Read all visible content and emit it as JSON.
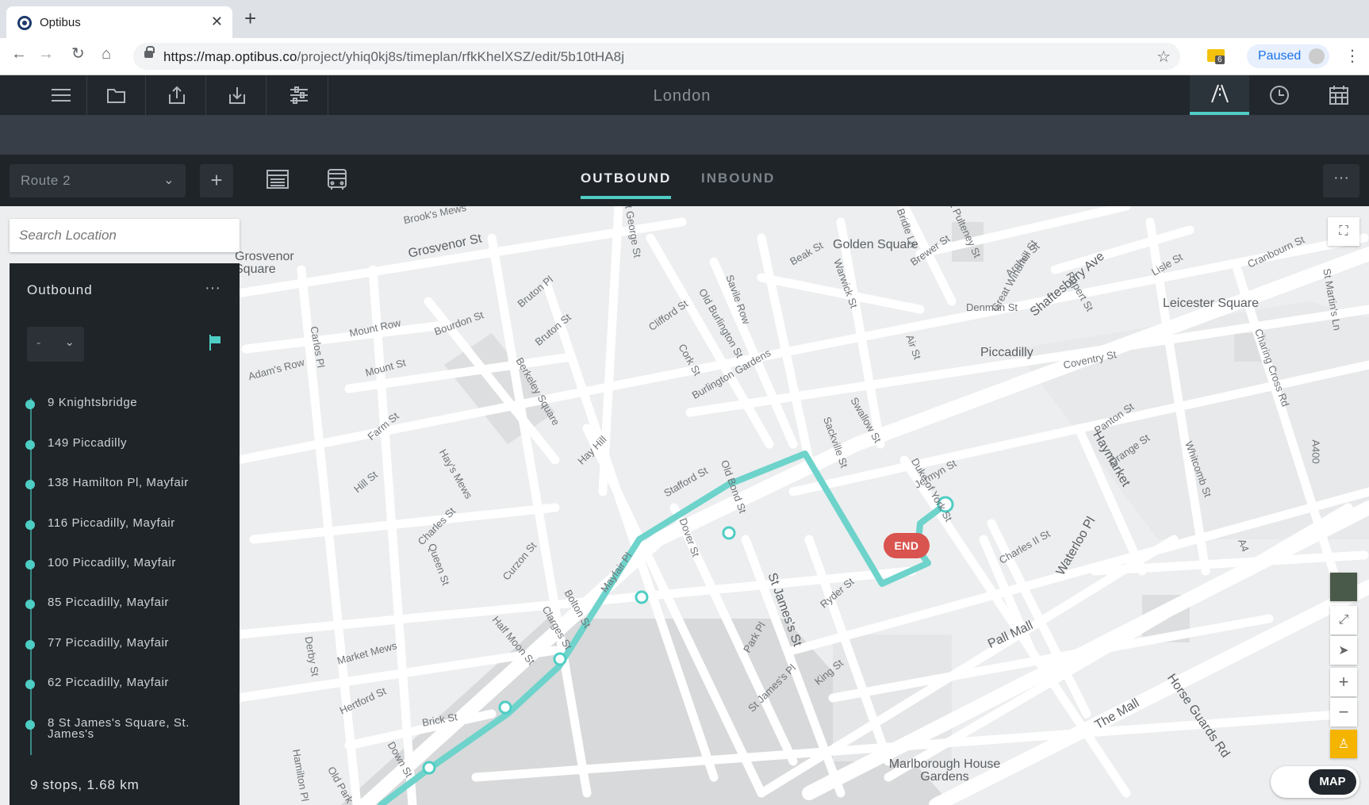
{
  "browser": {
    "tab_title": "Optibus",
    "url_host": "https://map.optibus.co",
    "url_path": "/project/yhiq0kj8s/timeplan/rfkKhelXSZ/edit/5b10tHA8j",
    "extension_badge": "6",
    "profile_label": "Paused"
  },
  "app": {
    "city": "London"
  },
  "routebar": {
    "route_selected": "Route 2",
    "tabs": [
      "OUTBOUND",
      "INBOUND"
    ],
    "active_tab": "OUTBOUND"
  },
  "search": {
    "placeholder": "Search Location"
  },
  "panel": {
    "title": "Outbound",
    "selector_value": "-",
    "stops": [
      "9 Knightsbridge",
      "149 Piccadilly",
      "138 Hamilton Pl, Mayfair",
      "116 Piccadilly, Mayfair",
      "100 Piccadilly, Mayfair",
      "85 Piccadilly, Mayfair",
      "77 Piccadilly, Mayfair",
      "62 Piccadilly, Mayfair",
      "8 St James's Square, St. James's"
    ],
    "summary": "9 stops, 1.68 km"
  },
  "map": {
    "end_label": "END",
    "map_type_label": "MAP",
    "route_color": "#4ecdc4",
    "labels": [
      {
        "text": "Brook's Mews"
      },
      {
        "text": "Grosvenor St"
      },
      {
        "text": "St George St"
      },
      {
        "text": "Golden Square"
      },
      {
        "text": "Beak St"
      },
      {
        "text": "Brewer St"
      },
      {
        "text": "Shaftesbury Ave"
      },
      {
        "text": "Leicester Square"
      },
      {
        "text": "Piccadilly"
      },
      {
        "text": "Coventry St"
      },
      {
        "text": "Denman St"
      },
      {
        "text": "Bruton Pl"
      },
      {
        "text": "Bruton St"
      },
      {
        "text": "Mount Row"
      },
      {
        "text": "Bourdon St"
      },
      {
        "text": "Adam's Row"
      },
      {
        "text": "Mount St"
      },
      {
        "text": "Clifford St"
      },
      {
        "text": "Old Burlington St"
      },
      {
        "text": "Savile Row"
      },
      {
        "text": "Burlington Gardens"
      },
      {
        "text": "Cork St"
      },
      {
        "text": "Berkeley Square"
      },
      {
        "text": "Hay Hill"
      },
      {
        "text": "Stafford St"
      },
      {
        "text": "Old Bond St"
      },
      {
        "text": "Sackville St"
      },
      {
        "text": "Swallow St"
      },
      {
        "text": "Jermyn St"
      },
      {
        "text": "Haymarket"
      },
      {
        "text": "Orange St"
      },
      {
        "text": "Panton St"
      },
      {
        "text": "Whitcomb St"
      },
      {
        "text": "Charing Cross Rd"
      },
      {
        "text": "A400"
      },
      {
        "text": "A4"
      },
      {
        "text": "Dover St"
      },
      {
        "text": "Mayfair Pl"
      },
      {
        "text": "Charles St"
      },
      {
        "text": "Hay's Mews"
      },
      {
        "text": "Hill St"
      },
      {
        "text": "Farm St"
      },
      {
        "text": "Curzon St"
      },
      {
        "text": "Queen St"
      },
      {
        "text": "Bolton St"
      },
      {
        "text": "Half Moon St"
      },
      {
        "text": "Clarges St"
      },
      {
        "text": "Market Mews"
      },
      {
        "text": "Hertford St"
      },
      {
        "text": "Derby St"
      },
      {
        "text": "Down St"
      },
      {
        "text": "Hamilton Pl"
      },
      {
        "text": "Old Park"
      },
      {
        "text": "Brick St"
      },
      {
        "text": "St James's St"
      },
      {
        "text": "Park Pl"
      },
      {
        "text": "St James's Pl"
      },
      {
        "text": "King St"
      },
      {
        "text": "Ryder St"
      },
      {
        "text": "Duke of York St"
      },
      {
        "text": "Charles II St"
      },
      {
        "text": "Waterloo Pl"
      },
      {
        "text": "Pall Mall"
      },
      {
        "text": "The Mall"
      },
      {
        "text": "Horse Guards Rd"
      },
      {
        "text": "Marlborough House Gardens"
      },
      {
        "text": "Carlos Pl"
      },
      {
        "text": "Great Windmill St"
      },
      {
        "text": "Archer St"
      },
      {
        "text": "Rupert St"
      },
      {
        "text": "Lisle St"
      },
      {
        "text": "Cranbourn St"
      },
      {
        "text": "St Martin's Ln"
      },
      {
        "text": "Air St"
      },
      {
        "text": "Warwick St"
      },
      {
        "text": "Bridle Ln"
      },
      {
        "text": "Great Pulteney St"
      },
      {
        "text": "Grosvenor Square"
      }
    ]
  }
}
